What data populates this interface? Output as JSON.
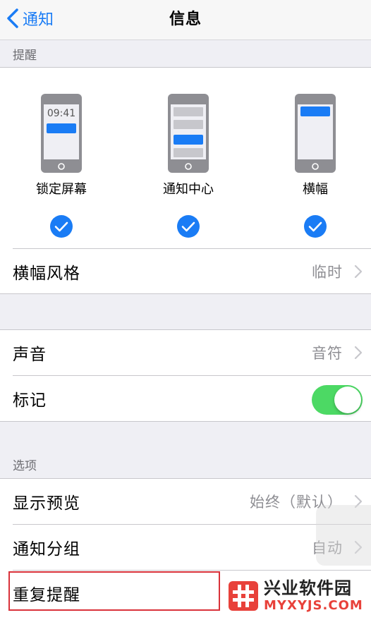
{
  "nav": {
    "back_label": "通知",
    "title": "信息"
  },
  "sections": {
    "alerts_header": "提醒",
    "options_header": "选项"
  },
  "alerts": {
    "lock_screen": {
      "label": "锁定屏幕",
      "time": "09:41",
      "checked": true
    },
    "notification_center": {
      "label": "通知中心",
      "checked": true
    },
    "banners": {
      "label": "横幅",
      "checked": true
    }
  },
  "rows": {
    "banner_style": {
      "label": "横幅风格",
      "value": "临时"
    },
    "sounds": {
      "label": "声音",
      "value": "音符"
    },
    "badges": {
      "label": "标记",
      "on": true
    },
    "show_previews": {
      "label": "显示预览",
      "value": "始终（默认）"
    },
    "grouping": {
      "label": "通知分组",
      "value": "自动"
    },
    "repeat_alerts": {
      "label": "重复提醒"
    }
  },
  "watermark": {
    "cn": "兴业软件园",
    "en": "MYXYJS.COM"
  },
  "colors": {
    "accent": "#1a7cf5",
    "toggle_on": "#4cd964",
    "highlight": "#d9323a",
    "watermark": "#e8413a"
  }
}
